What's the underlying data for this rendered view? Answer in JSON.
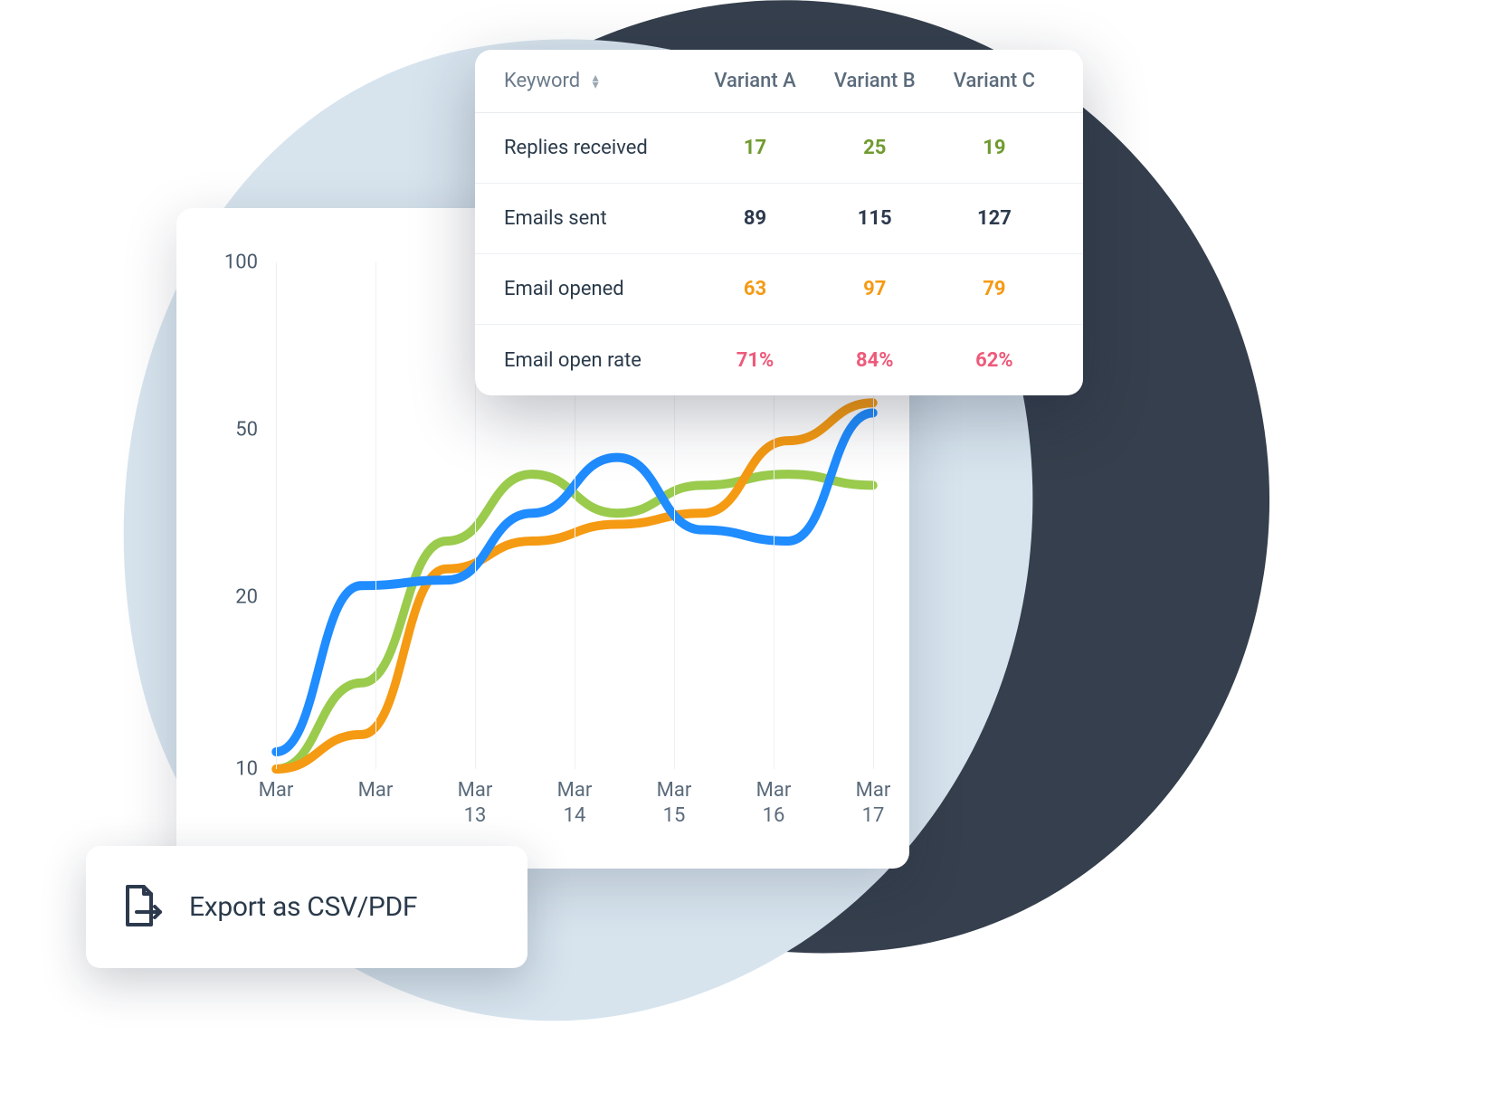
{
  "blob_colors": {
    "bg": "#d7e4ee",
    "shadow": "#1f2a3a"
  },
  "chart_data": {
    "type": "line",
    "ylabel": "",
    "xlabel": "",
    "y_ticks": [
      100,
      50,
      20,
      10
    ],
    "categories": [
      "Mar",
      "Mar",
      "Mar 13",
      "Mar 14",
      "Mar 15",
      "Mar 16",
      "Mar 17"
    ],
    "ylim": [
      10,
      100
    ],
    "series": [
      {
        "name": "Blue",
        "color": "#1f8cff",
        "values": [
          11,
          22,
          23,
          35,
          45,
          32,
          30,
          55
        ]
      },
      {
        "name": "Orange",
        "color": "#f59a13",
        "values": [
          10,
          12,
          25,
          30,
          33,
          35,
          48,
          58
        ]
      },
      {
        "name": "Green",
        "color": "#9acb4d",
        "values": [
          10,
          15,
          30,
          42,
          35,
          40,
          42,
          40
        ]
      }
    ]
  },
  "table": {
    "header_keyword": "Keyword",
    "variants": [
      "Variant A",
      "Variant B",
      "Variant C"
    ],
    "rows": [
      {
        "label": "Replies received",
        "color": "green",
        "values": [
          "17",
          "25",
          "19"
        ]
      },
      {
        "label": "Emails sent",
        "color": "dark",
        "values": [
          "89",
          "115",
          "127"
        ]
      },
      {
        "label": "Email opened",
        "color": "orange",
        "values": [
          "63",
          "97",
          "79"
        ]
      },
      {
        "label": "Email open rate",
        "color": "pink",
        "values": [
          "71%",
          "84%",
          "62%"
        ]
      }
    ]
  },
  "export": {
    "label": "Export as CSV/PDF"
  }
}
